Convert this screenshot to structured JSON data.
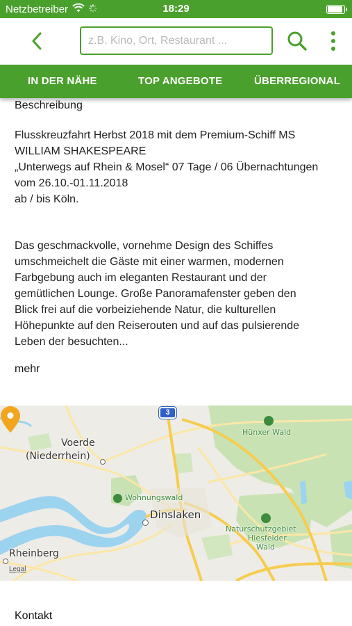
{
  "status_bar": {
    "carrier": "Netzbetreiber",
    "time": "18:29",
    "battery_level": 0.95
  },
  "header": {
    "search_placeholder": "z.B. Kino, Ort, Restaurant ...",
    "back_icon": "chevron-left-icon",
    "search_icon": "search-icon",
    "more_icon": "more-vertical-icon"
  },
  "tabs": [
    {
      "label": "IN DER NÄHE"
    },
    {
      "label": "TOP ANGEBOTE"
    },
    {
      "label": "ÜBERREGIONAL"
    }
  ],
  "description": {
    "title": "Beschreibung",
    "paragraph1_lines": [
      "Flusskreuzfahrt Herbst 2018 mit dem Premium-Schiff MS",
      "WILLIAM SHAKESPEARE",
      "„Unterwegs auf Rhein & Mosel“ 07 Tage / 06 Übernachtungen",
      "vom 26.10.-01.11.2018",
      "ab / bis Köln."
    ],
    "paragraph2_lines": [
      "Das geschmackvolle, vornehme Design des Schiffes",
      "umschmeichelt die Gäste mit einer warmen, modernen",
      "Farbgebung auch im eleganten Restaurant und der",
      "gemütlichen Lounge. Große Panoramafenster geben den",
      "Blick frei auf die vorbeiziehende Natur, die kulturellen",
      "Höhepunkte auf den Reiserouten und auf das pulsierende",
      "Leben der besuchten..."
    ],
    "more_label": "mehr"
  },
  "map": {
    "labels": {
      "voerde": "Voerde",
      "niederrhein": "(Niederrhein)",
      "wohnungswald": "Wohnungswald",
      "dinslaken": "Dinslaken",
      "huenxer_wald": "Hünxer Wald",
      "naturschutz_1": "Naturschutzgebiet",
      "naturschutz_2": "Hiesfelder",
      "naturschutz_3": "Wald",
      "rheinberg": "Rheinberg"
    },
    "route_number": "3",
    "legal": "Legal",
    "colors": {
      "background": "#eeece6",
      "water": "#9cd3ef",
      "forest": "#c8e2b4",
      "road_major": "#f6cc4f",
      "road_minor": "#fbe7a6",
      "pin": "#f2a51f"
    }
  },
  "contact": {
    "title": "Kontakt"
  },
  "theme": {
    "brand_green": "#4aa02c"
  }
}
